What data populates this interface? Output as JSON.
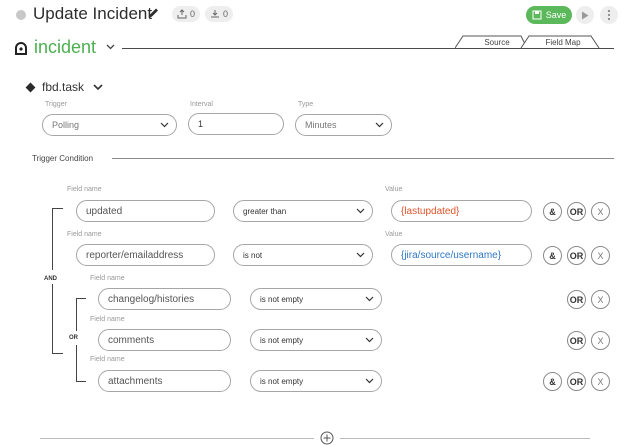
{
  "header": {
    "title": "Update Incident",
    "upload_count": "0",
    "download_count": "0",
    "save_label": "Save"
  },
  "object": {
    "name": "incident",
    "tabs": [
      {
        "label": "Source"
      },
      {
        "label": "Field Map"
      }
    ]
  },
  "task": {
    "name": "fbd.task",
    "trigger_label": "Trigger",
    "trigger_value": "Polling",
    "interval_label": "Interval",
    "interval_value": "1",
    "type_label": "Type",
    "type_value": "Minutes"
  },
  "trigger_condition": {
    "label": "Trigger Condition",
    "and_label": "AND",
    "or_label": "OR",
    "field_name_label": "Field name",
    "value_label": "Value",
    "conditions": [
      {
        "field": "updated",
        "operator": "greater than",
        "value": "{lastupdated}"
      },
      {
        "field": "reporter/emailaddress",
        "operator": "is not",
        "value": "{jira/source/username}"
      }
    ],
    "or_conditions": [
      {
        "field": "changelog/histories",
        "operator": "is not empty"
      },
      {
        "field": "comments",
        "operator": "is not empty"
      },
      {
        "field": "attachments",
        "operator": "is not empty"
      }
    ],
    "and_btn": "&",
    "or_btn": "OR",
    "remove_btn": "X"
  },
  "colors": {
    "accent_green": "#4caf50",
    "save_green": "#5bb85b",
    "value_red": "#e2552b",
    "value_blue": "#2f77c7"
  }
}
